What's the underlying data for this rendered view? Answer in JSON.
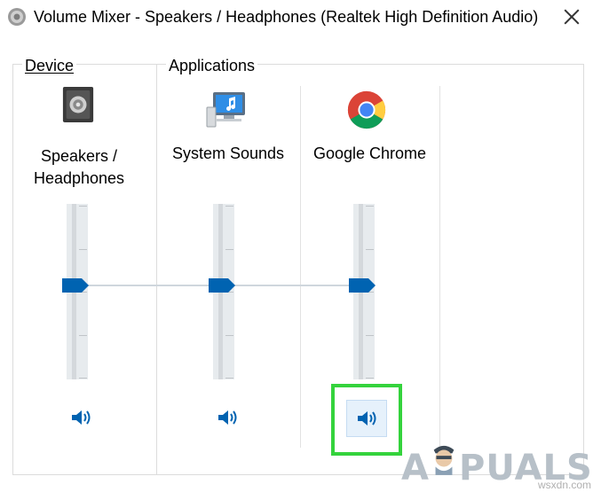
{
  "window": {
    "title": "Volume Mixer - Speakers / Headphones (Realtek High Definition Audio)",
    "app_icon": "speaker-icon",
    "close_icon": "close-icon"
  },
  "device": {
    "group_label": "Device",
    "label_line1": "Speakers /",
    "label_line2": "Headphones",
    "icon": "speaker-device-icon",
    "volume": 0.5,
    "mute_icon": "speaker-volume-icon"
  },
  "applications": {
    "group_label": "Applications",
    "items": [
      {
        "label": "System Sounds",
        "icon": "system-sounds-icon",
        "volume": 0.5,
        "mute_icon": "speaker-volume-icon"
      },
      {
        "label": "Google Chrome",
        "icon": "chrome-icon",
        "volume": 0.5,
        "mute_icon": "speaker-volume-icon",
        "highlighted": true
      }
    ]
  },
  "colors": {
    "accent": "#0063b1",
    "highlight": "#34d33c",
    "track": "#e7ebee"
  },
  "watermark": {
    "text": "PUALS",
    "source": "wsxdn.com"
  }
}
